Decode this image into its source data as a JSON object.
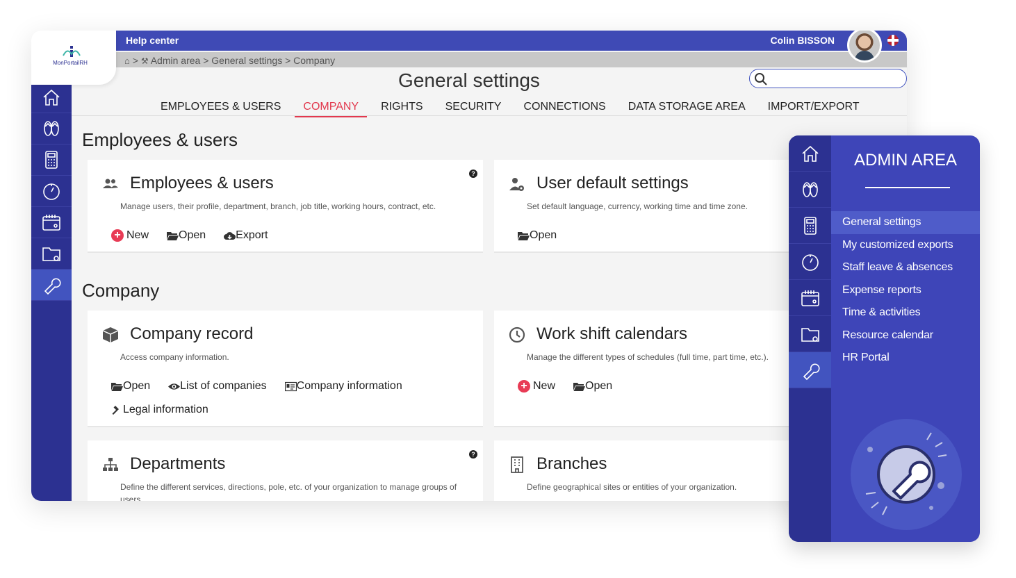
{
  "logo": {
    "text": "MonPortailRH"
  },
  "topbar": {
    "help": "Help center",
    "user": "Colin  BISSON"
  },
  "breadcrumb": {
    "text": "Admin area > General settings > Company",
    "sep": ">"
  },
  "page_title": "General settings",
  "search": {
    "placeholder": ""
  },
  "tabs": [
    {
      "label": "EMPLOYEES & USERS",
      "active": false
    },
    {
      "label": "COMPANY",
      "active": true
    },
    {
      "label": "RIGHTS",
      "active": false
    },
    {
      "label": "SECURITY",
      "active": false
    },
    {
      "label": "CONNECTIONS",
      "active": false
    },
    {
      "label": "DATA STORAGE AREA",
      "active": false
    },
    {
      "label": "IMPORT/EXPORT",
      "active": false
    }
  ],
  "sections": {
    "employees": "Employees & users",
    "company": "Company"
  },
  "cards": {
    "employees_users": {
      "title": "Employees & users",
      "desc": "Manage users, their profile, department, branch, job title, working hours, contract, etc.",
      "help": "?",
      "actions": [
        "New",
        "Open",
        "Export"
      ]
    },
    "user_defaults": {
      "title": "User default settings",
      "desc": "Set default language, currency, working time and time zone.",
      "actions": [
        "Open"
      ]
    },
    "company_record": {
      "title": "Company record",
      "desc": "Access company information.",
      "actions": [
        "Open",
        "List of companies",
        "Company information",
        "Legal information"
      ]
    },
    "work_shift": {
      "title": "Work shift calendars",
      "desc": "Manage the different types of schedules (full time, part time, etc.).",
      "actions": [
        "New",
        "Open"
      ]
    },
    "departments": {
      "title": "Departments",
      "desc": "Define the different services, directions, pole, etc. of your organization to manage groups of users.",
      "help": "?"
    },
    "branches": {
      "title": "Branches",
      "desc": "Define geographical sites or entities of your organization."
    }
  },
  "admin_panel": {
    "title": "ADMIN AREA",
    "items": [
      {
        "label": "General settings",
        "active": true
      },
      {
        "label": "My customized exports",
        "active": false
      },
      {
        "label": "Staff leave & absences",
        "active": false
      },
      {
        "label": "Expense reports",
        "active": false
      },
      {
        "label": "Time & activities",
        "active": false
      },
      {
        "label": "Resource calendar",
        "active": false
      },
      {
        "label": "HR Portal",
        "active": false
      }
    ]
  },
  "icons": [
    "home-icon",
    "flip-flops-icon",
    "calculator-icon",
    "stopwatch-icon",
    "calendar-icon",
    "folder-icon",
    "wrench-icon"
  ],
  "colors": {
    "primary": "#3f4ab5",
    "sidebar": "#2c3191",
    "accent": "#e2384d",
    "plus": "#e83b55"
  }
}
